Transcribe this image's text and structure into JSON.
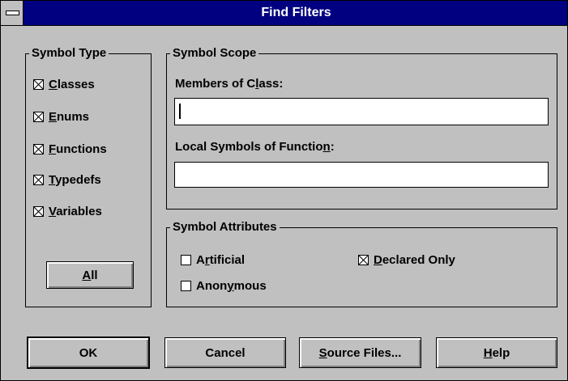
{
  "window": {
    "title": "Find Filters"
  },
  "symbol_type": {
    "legend": "Symbol Type",
    "items": [
      {
        "pre": "",
        "key": "C",
        "post": "lasses",
        "checked": true
      },
      {
        "pre": "",
        "key": "E",
        "post": "nums",
        "checked": true
      },
      {
        "pre": "",
        "key": "F",
        "post": "unctions",
        "checked": true
      },
      {
        "pre": "",
        "key": "T",
        "post": "ypedefs",
        "checked": true
      },
      {
        "pre": "",
        "key": "V",
        "post": "ariables",
        "checked": true
      }
    ],
    "all_button": {
      "pre": "",
      "key": "A",
      "post": "ll"
    }
  },
  "symbol_scope": {
    "legend": "Symbol Scope",
    "members_label": {
      "pre": "Members of C",
      "key": "l",
      "post": "ass:"
    },
    "members_value": "",
    "local_label": {
      "pre": "Local Symbols of Functio",
      "key": "n",
      "post": ":"
    },
    "local_value": ""
  },
  "symbol_attributes": {
    "legend": "Symbol Attributes",
    "artificial": {
      "pre": "A",
      "key": "r",
      "post": "tificial",
      "checked": false
    },
    "anonymous": {
      "pre": "Anon",
      "key": "y",
      "post": "mous",
      "checked": false
    },
    "declared_only": {
      "pre": "",
      "key": "D",
      "post": "eclared Only",
      "checked": true
    }
  },
  "buttons": {
    "ok": "OK",
    "cancel": "Cancel",
    "source_files": {
      "pre": "",
      "key": "S",
      "post": "ource Files..."
    },
    "help": {
      "pre": "",
      "key": "H",
      "post": "elp"
    }
  }
}
